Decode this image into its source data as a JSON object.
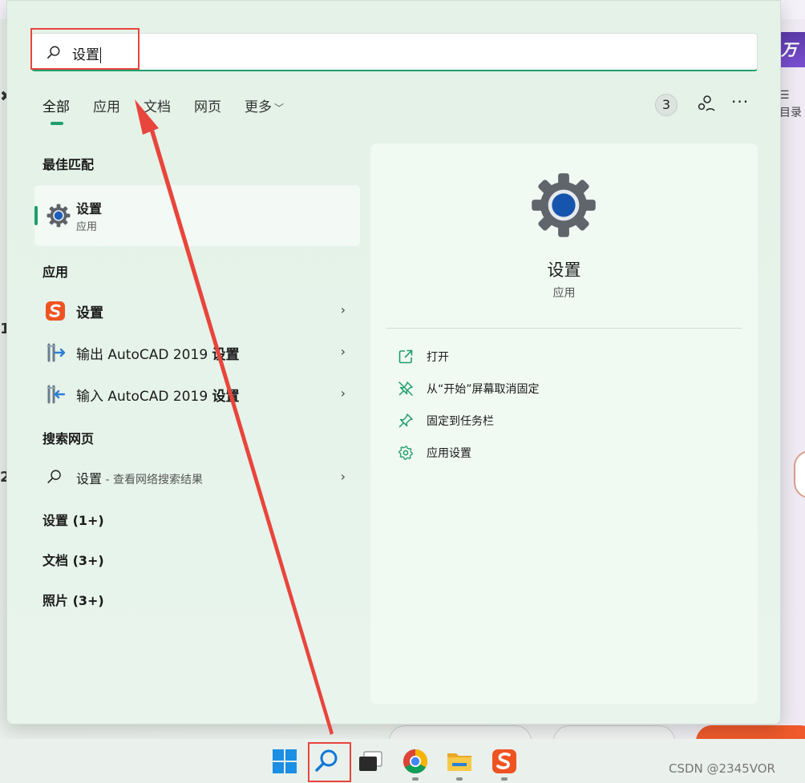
{
  "search": {
    "query": "设置"
  },
  "tabs": [
    {
      "label": "全部"
    },
    {
      "label": "应用"
    },
    {
      "label": "文档"
    },
    {
      "label": "网页"
    },
    {
      "label": "更多"
    }
  ],
  "toolbar": {
    "count": "3"
  },
  "best_match": {
    "title": "最佳匹配",
    "name": "设置",
    "type": "应用"
  },
  "apps": {
    "title": "应用",
    "items": [
      {
        "name": "设置"
      },
      {
        "prefix": "输出 AutoCAD 2019 ",
        "bold": "设置"
      },
      {
        "prefix": "输入 AutoCAD 2019 ",
        "bold": "设置"
      }
    ]
  },
  "web": {
    "title": "搜索网页",
    "query": "设置",
    "suffix": " - 查看网络搜索结果"
  },
  "groups": [
    {
      "label": "设置 (1+)"
    },
    {
      "label": "文档 (3+)"
    },
    {
      "label": "照片 (3+)"
    }
  ],
  "detail": {
    "name": "设置",
    "type": "应用",
    "actions": [
      {
        "label": "打开",
        "icon": "open-icon"
      },
      {
        "label": "从“开始”屏幕取消固定",
        "icon": "unpin-icon"
      },
      {
        "label": "固定到任务栏",
        "icon": "pin-icon"
      },
      {
        "label": "应用设置",
        "icon": "gear-icon"
      }
    ]
  },
  "taskbar": {
    "items": [
      "windows-start-icon",
      "search-icon",
      "task-view-icon",
      "chrome-icon",
      "file-explorer-icon",
      "sogou-input-icon"
    ]
  },
  "watermark": "CSDN @2345VOR",
  "colors": {
    "accent": "#1f9e6b",
    "annotation": "#e8453c",
    "panel": "#e6f3ea"
  }
}
